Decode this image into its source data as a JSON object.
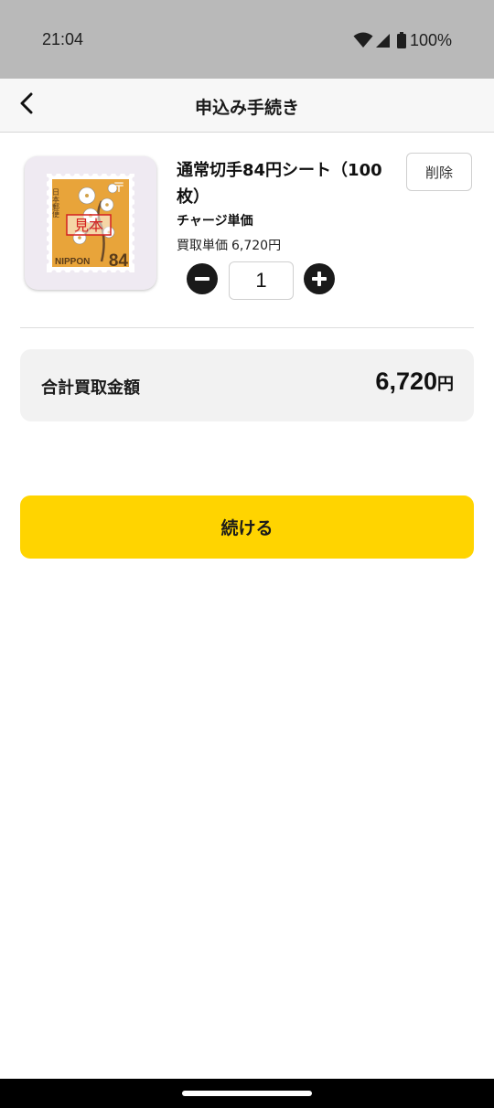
{
  "status_bar": {
    "time": "21:04",
    "battery": "100%",
    "icons": [
      "wifi-icon",
      "signal-icon",
      "battery-icon"
    ]
  },
  "header": {
    "title": "申込み手続き",
    "back_icon": "chevron-left-icon"
  },
  "cart_item": {
    "name": "通常切手84円シート（100枚）",
    "type_label": "チャージ単価",
    "unit_price_label": "買取単価",
    "unit_price_value": "6,720円",
    "delete_label": "削除",
    "quantity": "1",
    "image": {
      "label_sample": "見本",
      "label_country": "NIPPON",
      "label_value": "84",
      "label_vertical": "日本郵便",
      "mark": "〒"
    }
  },
  "total": {
    "label": "合計買取金額",
    "amount": "6,720",
    "unit": "円"
  },
  "actions": {
    "continue_label": "続ける"
  },
  "colors": {
    "accent": "#ffd400",
    "status_bar": "#b9b9b9",
    "stamp_orange": "#e8a43a"
  }
}
